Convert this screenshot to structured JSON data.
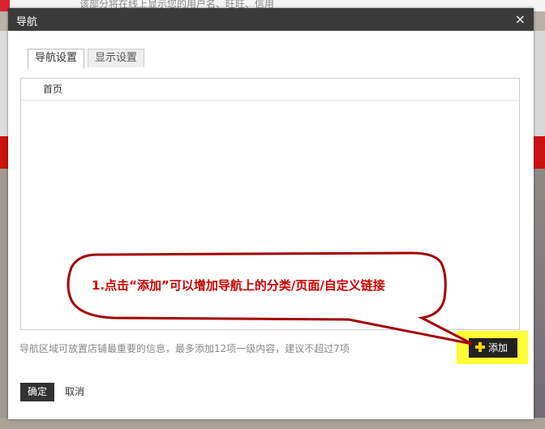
{
  "background": {
    "snippet_text": "该部分将在线上显示您的用户名、旺旺、信用"
  },
  "dialog": {
    "title": "导航",
    "close_symbol": "×",
    "tabs": [
      {
        "label": "导航设置",
        "active": true
      },
      {
        "label": "显示设置",
        "active": false
      }
    ],
    "nav_items": [
      {
        "label": "首页"
      }
    ],
    "hint": "导航区域可放置店铺最重要的信息，最多添加12项一级内容，建议不超过7项",
    "add_label": "添加",
    "ok_label": "确定",
    "cancel_label": "取消"
  },
  "annotation": {
    "text": "1.点击“添加”可以增加导航上的分类/页面/自定义链接",
    "color": "#cc0000",
    "highlight_color": "#ffff33"
  }
}
